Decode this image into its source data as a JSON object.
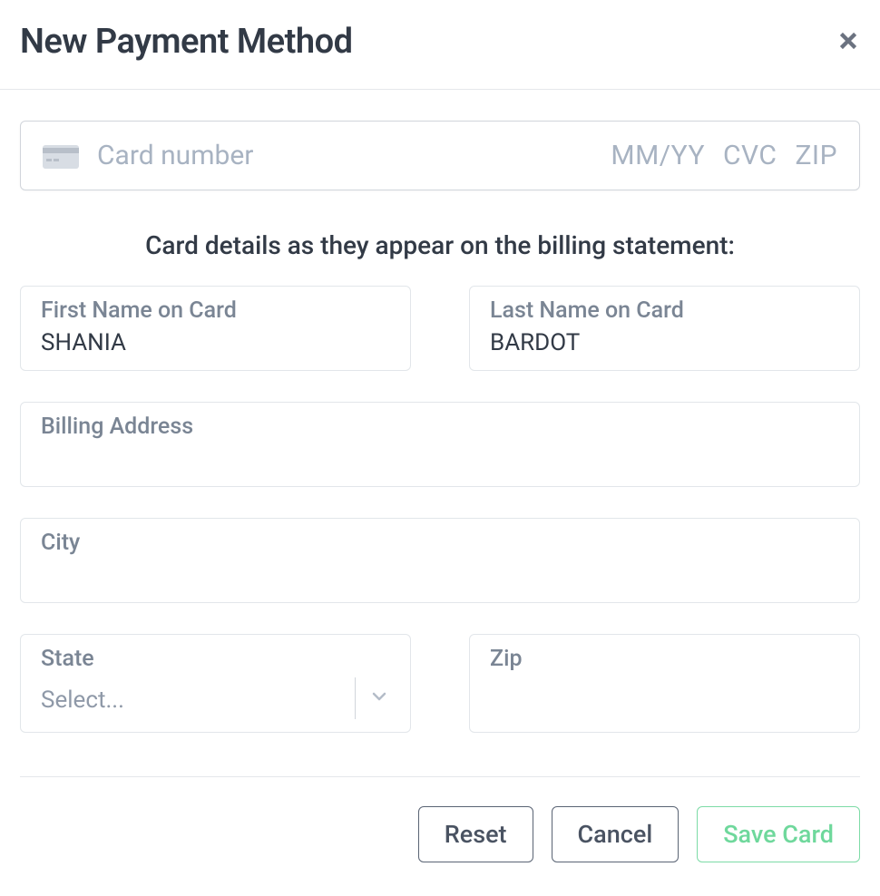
{
  "header": {
    "title": "New Payment Method"
  },
  "cardField": {
    "numberPlaceholder": "Card number",
    "expiryPlaceholder": "MM/YY",
    "cvcPlaceholder": "CVC",
    "zipPlaceholder": "ZIP"
  },
  "sectionHeading": "Card details as they appear on the billing statement:",
  "fields": {
    "firstName": {
      "label": "First Name on Card",
      "value": "SHANIA"
    },
    "lastName": {
      "label": "Last Name on Card",
      "value": "BARDOT"
    },
    "billingAddress": {
      "label": "Billing Address",
      "value": ""
    },
    "city": {
      "label": "City",
      "value": ""
    },
    "state": {
      "label": "State",
      "placeholder": "Select..."
    },
    "zip": {
      "label": "Zip",
      "value": ""
    }
  },
  "buttons": {
    "reset": "Reset",
    "cancel": "Cancel",
    "save": "Save Card"
  }
}
